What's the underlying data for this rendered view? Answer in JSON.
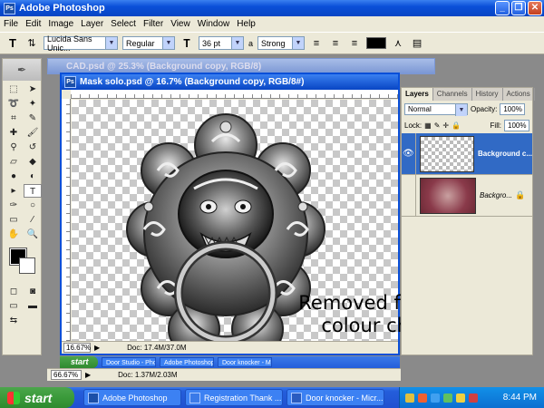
{
  "window": {
    "title": "Adobe Photoshop",
    "app_icon": "Ps"
  },
  "menu": [
    "File",
    "Edit",
    "Image",
    "Layer",
    "Select",
    "Filter",
    "View",
    "Window",
    "Help"
  ],
  "options": {
    "font_family": "Lucida Sans Unic...",
    "font_style": "Regular",
    "font_size": "36 pt",
    "aa_label": "a",
    "antialias": "Strong"
  },
  "back_doc": {
    "title": "CAD.psd @ 25.3% (Background copy, RGB/8)"
  },
  "doc": {
    "title": "Mask solo.psd @ 16.7% (Background copy, RGB/8#)",
    "zoom": "16.67%",
    "doc_size": "Doc: 17.4M/37.0M"
  },
  "outer": {
    "zoom": "66.67%",
    "doc_size": "Doc: 1.37M/2.03M"
  },
  "annotation": [
    "Removed from b/ground",
    "colour changed H/S"
  ],
  "nested_taskbar": {
    "start": "start",
    "items": [
      "Door Studio - Pho...",
      "Adobe Photoshop",
      "Door knocker - Mic..."
    ]
  },
  "layers": {
    "tabs": [
      "Layers",
      "Channels",
      "History",
      "Actions"
    ],
    "blend_mode": "Normal",
    "opacity_label": "Opacity:",
    "opacity": "100%",
    "lock_label": "Lock:",
    "fill_label": "Fill:",
    "fill": "100%",
    "items": [
      {
        "name": "Background c..."
      },
      {
        "name": "Backgro..."
      }
    ]
  },
  "taskbar": {
    "start": "start",
    "items": [
      "Adobe Photoshop",
      "Registration Thank ...",
      "Door knocker - Micr..."
    ],
    "clock": "8:44 PM"
  }
}
